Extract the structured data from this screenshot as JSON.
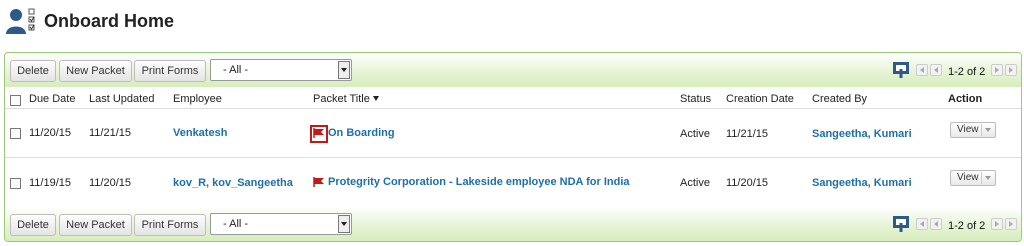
{
  "page": {
    "title": "Onboard Home",
    "icon": "user-checklist-icon"
  },
  "toolbar": {
    "delete_label": "Delete",
    "new_packet_label": "New Packet",
    "print_forms_label": "Print Forms",
    "filter_value": "- All -",
    "pager_text": "1-2 of 2"
  },
  "columns": {
    "due_date": "Due Date",
    "last_updated": "Last Updated",
    "employee": "Employee",
    "packet_title": "Packet Title",
    "status": "Status",
    "creation_date": "Creation Date",
    "created_by": "Created By",
    "action": "Action"
  },
  "rows": [
    {
      "due_date": "11/20/15",
      "last_updated": "11/21/15",
      "employee": "Venkatesh",
      "packet_title": "On Boarding",
      "status": "Active",
      "creation_date": "11/21/15",
      "created_by": "Sangeetha, Kumari",
      "action": "View"
    },
    {
      "due_date": "11/19/15",
      "last_updated": "11/20/15",
      "employee": "kov_R, kov_Sangeetha",
      "packet_title": "Protegrity Corporation - Lakeside employee NDA for India",
      "status": "Active",
      "creation_date": "11/20/15",
      "created_by": "Sangeetha, Kumari",
      "action": "View"
    }
  ],
  "colors": {
    "accent_green": "#d6edbd",
    "link_blue": "#1e6fa8",
    "flag_red": "#c01a1a"
  }
}
